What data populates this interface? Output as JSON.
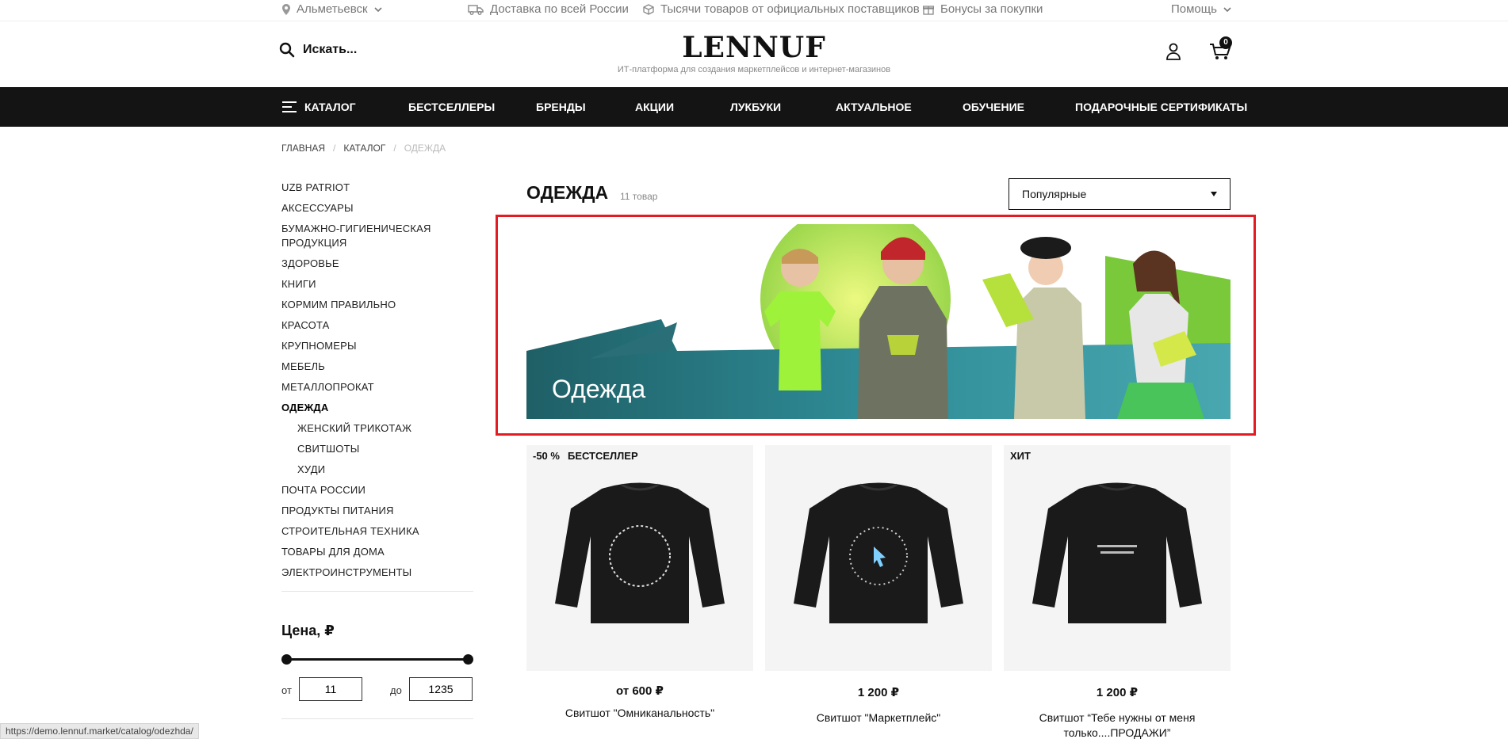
{
  "topbar": {
    "city": "Альметьевск",
    "delivery": "Доставка по всей России",
    "suppliers": "Тысячи товаров от официальных поставщиков",
    "bonuses": "Бонусы за покупки",
    "help": "Помощь"
  },
  "header": {
    "search_placeholder": "Искать...",
    "logo": "LENNUF",
    "tagline": "ИТ-платформа для создания маркетплейсов и интернет-магазинов",
    "cart_count": "0"
  },
  "nav": {
    "catalog": "Каталог",
    "items": [
      "Бестселлеры",
      "Бренды",
      "Акции",
      "Лукбуки",
      "Актуальное",
      "Обучение",
      "Подарочные сертификаты"
    ]
  },
  "breadcrumb": {
    "home": "ГЛАВНАЯ",
    "catalog": "КАТАЛОГ",
    "current": "ОДЕЖДА"
  },
  "sidebar": {
    "categories": [
      "UZB PATRIOT",
      "Аксессуары",
      "Бумажно-гигиеническая продукция",
      "Здоровье",
      "Книги",
      "Кормим правильно",
      "Красота",
      "Крупномеры",
      "Мебель",
      "Металлопрокат",
      "Одежда",
      "Женский трикотаж",
      "Свитшоты",
      "Худи",
      "Почта России",
      "Продукты питания",
      "Строительная техника",
      "Товары для дома",
      "Электроинструменты"
    ],
    "price_title": "Цена, ₽",
    "from_label": "от",
    "to_label": "до",
    "price_min": "11",
    "price_max": "1235",
    "slider_min_fraction": 0,
    "slider_max_fraction": 1
  },
  "main": {
    "title": "Одежда",
    "count": "11 товар",
    "sort_value": "Популярные",
    "banner_title": "Одежда"
  },
  "products": [
    {
      "discount": "-50 %",
      "badge": "БЕСТСЕЛЛЕР",
      "price": "от 600 ₽",
      "name": "Свитшот \"Омниканальность\""
    },
    {
      "discount": "",
      "badge": "",
      "price": "1 200 ₽",
      "name": "Свитшот \"Маркетплейс\""
    },
    {
      "discount": "",
      "badge": "ХИТ",
      "price": "1 200 ₽",
      "name": "Свитшот “Тебе нужны от меня только....ПРОДАЖИ”"
    }
  ],
  "status_url": "https://demo.lennuf.market/catalog/odezhda/",
  "colors": {
    "nav_bg": "#141414",
    "highlight_frame": "#e31c24",
    "banner_teal": "#2f8d98",
    "banner_green": "#8ad02c"
  }
}
